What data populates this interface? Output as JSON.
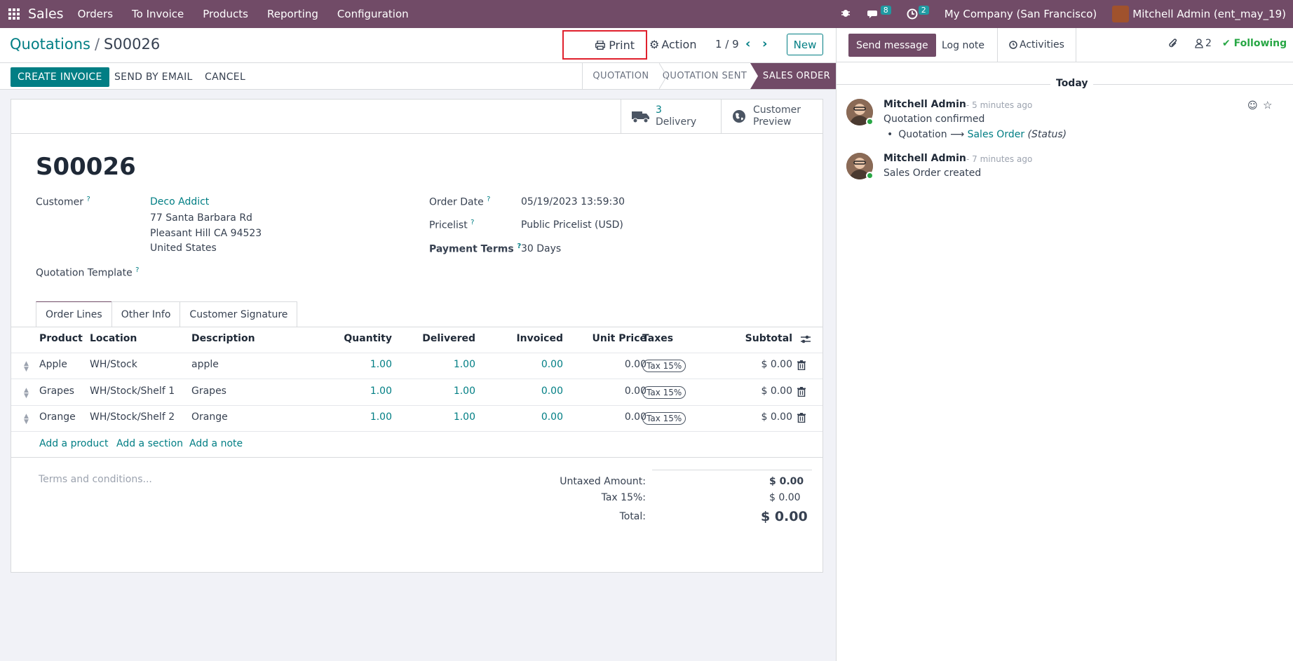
{
  "navbar": {
    "brand": "Sales",
    "menus": [
      "Orders",
      "To Invoice",
      "Products",
      "Reporting",
      "Configuration"
    ],
    "messages_count": "8",
    "activities_count": "2",
    "company": "My Company (San Francisco)",
    "user": "Mitchell Admin (ent_may_19)"
  },
  "control": {
    "breadcrumb_parent": "Quotations",
    "breadcrumb_sep": "/",
    "breadcrumb_current": "S00026",
    "print_label": "Print",
    "action_label": "Action",
    "pager": "1 / 9",
    "new_label": "New"
  },
  "statusbar": {
    "create_invoice": "CREATE INVOICE",
    "send_by_email": "SEND BY EMAIL",
    "cancel": "CANCEL",
    "stages": [
      "QUOTATION",
      "QUOTATION SENT",
      "SALES ORDER"
    ]
  },
  "smart_buttons": {
    "delivery_count": "3",
    "delivery_label": "Delivery",
    "customer_preview_1": "Customer",
    "customer_preview_2": "Preview"
  },
  "form": {
    "name": "S00026",
    "customer_label": "Customer",
    "customer_name": "Deco Addict",
    "addr1": "77 Santa Barbara Rd",
    "addr2": "Pleasant Hill CA 94523",
    "addr3": "United States",
    "template_label": "Quotation Template",
    "order_date_label": "Order Date",
    "order_date": "05/19/2023 13:59:30",
    "pricelist_label": "Pricelist",
    "pricelist": "Public Pricelist (USD)",
    "payment_terms_label": "Payment Terms",
    "payment_terms": "30 Days"
  },
  "tabs": [
    "Order Lines",
    "Other Info",
    "Customer Signature"
  ],
  "table": {
    "headers": [
      "Product",
      "Location",
      "Description",
      "Quantity",
      "Delivered",
      "Invoiced",
      "Unit Price",
      "Taxes",
      "Subtotal"
    ],
    "rows": [
      {
        "product": "Apple",
        "location": "WH/Stock",
        "description": "apple",
        "quantity": "1.00",
        "delivered": "1.00",
        "invoiced": "0.00",
        "unit_price": "0.00",
        "tax": "Tax 15%",
        "subtotal": "$ 0.00"
      },
      {
        "product": "Grapes",
        "location": "WH/Stock/Shelf 1",
        "description": "Grapes",
        "quantity": "1.00",
        "delivered": "1.00",
        "invoiced": "0.00",
        "unit_price": "0.00",
        "tax": "Tax 15%",
        "subtotal": "$ 0.00"
      },
      {
        "product": "Orange",
        "location": "WH/Stock/Shelf 2",
        "description": "Orange",
        "quantity": "1.00",
        "delivered": "1.00",
        "invoiced": "0.00",
        "unit_price": "0.00",
        "tax": "Tax 15%",
        "subtotal": "$ 0.00"
      }
    ],
    "add_product": "Add a product",
    "add_section": "Add a section",
    "add_note": "Add a note"
  },
  "terms_placeholder": "Terms and conditions...",
  "totals": {
    "untaxed_label": "Untaxed Amount:",
    "untaxed": "$ 0.00",
    "tax_label": "Tax 15%:",
    "tax": "$ 0.00",
    "total_label": "Total:",
    "total": "$ 0.00"
  },
  "chatter": {
    "send_message": "Send message",
    "log_note": "Log note",
    "activities": "Activities",
    "followers_count": "2",
    "following": "Following",
    "today": "Today",
    "messages": [
      {
        "author": "Mitchell Admin",
        "ago": "- 5 minutes ago",
        "body": "Quotation confirmed",
        "tracking_old": "Quotation",
        "tracking_new": "Sales Order",
        "tracking_field": "(Status)"
      },
      {
        "author": "Mitchell Admin",
        "ago": "- 7 minutes ago",
        "body": "Sales Order created"
      }
    ]
  },
  "colors": {
    "brand": "#714b67",
    "accent": "#017e84",
    "highlight": "#e0202d"
  }
}
